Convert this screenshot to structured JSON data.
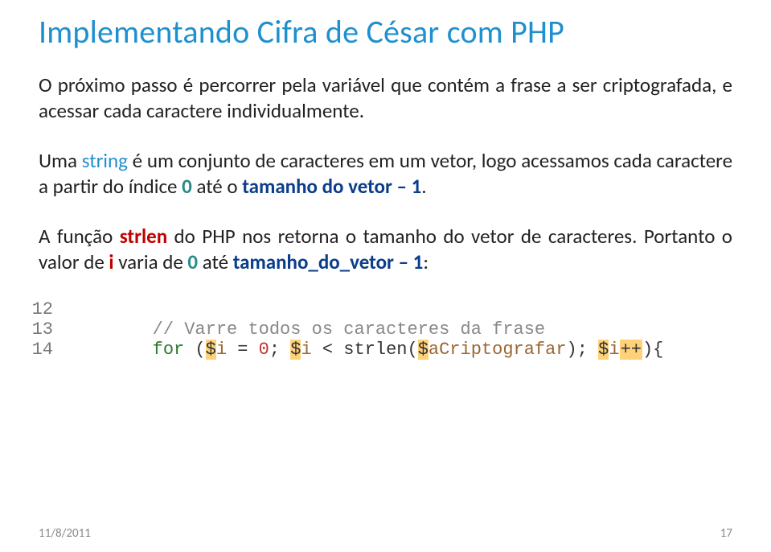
{
  "title": "Implementando Cifra de César com PHP",
  "p1_a": "O próximo passo é percorrer pela variável que contém a frase a ser criptografada, e acessar cada caractere individualmente.",
  "p2_a": "Uma ",
  "p2_b": "string",
  "p2_c": " é um conjunto de caracteres em um vetor, logo acessamos cada caractere a partir do índice ",
  "p2_d": "0",
  "p2_e": " até o ",
  "p2_f": "tamanho do vetor – 1",
  "p2_g": ".",
  "p3_a": "A função ",
  "p3_b": "strlen",
  "p3_c": " do PHP nos retorna o tamanho do vetor de caracteres. Portanto o valor de ",
  "p3_d": "i",
  "p3_e": " varia de ",
  "p3_f": "0",
  "p3_g": " até ",
  "p3_h": "tamanho_do_vetor – 1",
  "p3_i": ":",
  "code": {
    "ln12": "12",
    "ln13": "13",
    "ln14": "14",
    "l13_comment": "// Varre todos os caracteres da frase",
    "for": "for",
    "lp": " (",
    "d1": "$",
    "v_i": "i",
    "eq0": " = ",
    "zero": "0",
    "semi1": "; ",
    "d2": "$",
    "lt": " < ",
    "strlen": "strlen",
    "lp2": "(",
    "d3": "$",
    "aCripto": "aCriptografar",
    "rp2": ")",
    "semi2": "; ",
    "d4": "$",
    "pp": "++",
    "rp": "){"
  },
  "footer_date": "11/8/2011",
  "footer_page": "17"
}
